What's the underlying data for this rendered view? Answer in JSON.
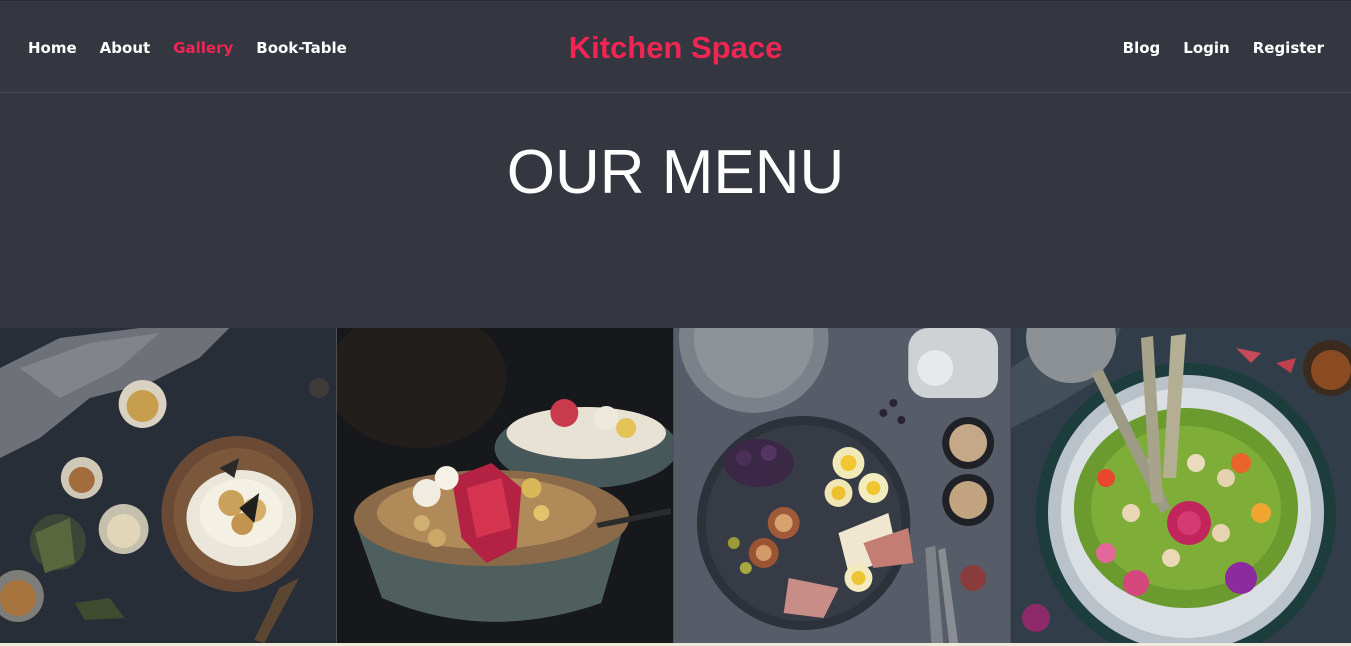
{
  "nav": {
    "left": [
      "Home",
      "About",
      "Gallery",
      "Book-Table"
    ],
    "right": [
      "Blog",
      "Login",
      "Register"
    ],
    "active": "Gallery"
  },
  "brand": "Kitchen Space",
  "hero": {
    "title": "OUR MENU"
  },
  "gallery": {
    "items": [
      {
        "icon": "dessert-plate-photo"
      },
      {
        "icon": "granola-bowl-photo"
      },
      {
        "icon": "fruit-platter-photo"
      },
      {
        "icon": "salad-bowl-photo"
      }
    ]
  },
  "colors": {
    "accent": "#ef2553",
    "header_bg": "#343740",
    "text": "#ffffff"
  }
}
